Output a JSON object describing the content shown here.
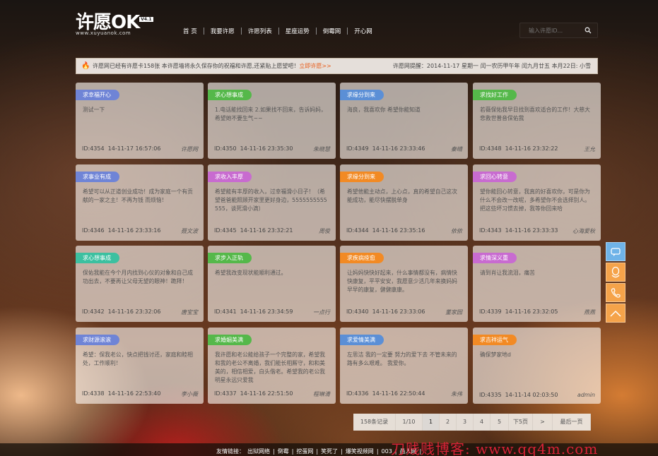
{
  "logo": {
    "main": "许愿OK",
    "badge": "V4.1",
    "sub": "www.xuyuanok.com"
  },
  "nav": [
    "首 页",
    "我要许愿",
    "许愿列表",
    "星座运势",
    "倒霉网",
    "开心网"
  ],
  "search": {
    "placeholder": "输入许愿ID..."
  },
  "notice": {
    "text": "许愿网已经有许愿卡158张   本许愿墙将永久保存你的祝福和许愿,还紧贴上愿望吧！",
    "link": "立即许愿>>",
    "date": "许愿网提醒：2014-11-17 星期一  闰一农历甲午年 闰九月廿五 本月22日: 小雪"
  },
  "cards": [
    {
      "tag": "求幸福开心",
      "color": "#6f84d6",
      "content": "测试一下",
      "id": "ID:4354",
      "time": "14-11-17 16:57:06",
      "author": "许愿网"
    },
    {
      "tag": "求心想事成",
      "color": "#55b84a",
      "content": "1.电话能找回来  2.如果找不回来，告诉妈妈，希望她不要生气~~",
      "id": "ID:4350",
      "time": "14-11-16 23:35:30",
      "author": "朱晓慧"
    },
    {
      "tag": "求缘分到来",
      "color": "#5b8fd6",
      "content": "海良，我喜欢你    希望你能知道",
      "id": "ID:4349",
      "time": "14-11-16 23:33:46",
      "author": "秦晴"
    },
    {
      "tag": "求找好工作",
      "color": "#55b84a",
      "content": "若薇保佑我早日找到喜欢适合的工作！大慈大悲救世普音保佑我",
      "id": "ID:4348",
      "time": "14-11-16 23:32:22",
      "author": "王允"
    },
    {
      "tag": "求事业有成",
      "color": "#6f84d6",
      "content": "希望可以从正道创业成功！成为家庭一个有贡献的一家之主！不再为钱    而烦恼！",
      "id": "ID:4346",
      "time": "14-11-16 23:33:16",
      "author": "聂文波"
    },
    {
      "tag": "求收入丰厚",
      "color": "#c86bd0",
      "content": "希望能有丰厚的收入，过幸福滑小日子！（希望爸爸能照顾开家里更好身边，5555555555555，谈死滑小滴）",
      "id": "ID:4345",
      "time": "14-11-16 23:32:21",
      "author": "周俊"
    },
    {
      "tag": "求缘分到来",
      "color": "#f28a24",
      "content": "希望他能主动点，上心点，真的希望自己这次能成功，能尽快摆脱单身",
      "id": "ID:4344",
      "time": "14-11-16 23:35:16",
      "author": "依依"
    },
    {
      "tag": "求回心转意",
      "color": "#c86bd0",
      "content": "望你能回心转意，我真的好喜欢你，可是你为什么不会改一改呢，多希望你不会选择别人。把这些坏习惯去掉，我等你回来哈",
      "id": "ID:4343",
      "time": "14-11-16 23:33:33",
      "author": "心海爱秋"
    },
    {
      "tag": "求心想事成",
      "color": "#3cc0a0",
      "content": "保佑我能在今个月内找到心仪的对象和自己成功出去，不要再让父母无望的眼神！跪拜！",
      "id": "ID:4342",
      "time": "14-11-16 23:32:06",
      "author": "唐宝宝"
    },
    {
      "tag": "求步入正轨",
      "color": "#55b84a",
      "content": "希望我改变现状能顺利通过。",
      "id": "ID:4341",
      "time": "14-11-16 23:34:59",
      "author": "一点行"
    },
    {
      "tag": "求疾病痊愈",
      "color": "#f28a24",
      "content": "让妈妈快快好起来，什么事情都没有，病情快快康复，平平安安，我愿意少活几年来换妈妈早早的康复，健健康康。",
      "id": "ID:4340",
      "time": "14-11-16 23:33:06",
      "author": "董家园"
    },
    {
      "tag": "求情深义重",
      "color": "#c86bd0",
      "content": "请到肖让我流泪，痛苦",
      "id": "ID:4339",
      "time": "14-11-16 23:32:05",
      "author": "燕燕"
    },
    {
      "tag": "求财源滚滚",
      "color": "#6f84d6",
      "content": "希望：保我老公，快点把钱讨还，家庭和睦相处，工作顺利！",
      "id": "ID:4338",
      "time": "14-11-16 22:53:40",
      "author": "李小薇"
    },
    {
      "tag": "求婚姻美满",
      "color": "#55b84a",
      "content": "我许愿和老公能给孩子一个完整的家，希望我和我的老公不离婚，我们能长相厮守，和和美美的，相信相爱，白头偕老。希望我的老公我明星永远只爱我",
      "id": "ID:4337",
      "time": "14-11-16 22:51:50",
      "author": "程琳清"
    },
    {
      "tag": "求爱情美满",
      "color": "#5b8fd6",
      "content": "左思洁 我的一定要 努力的爱下去 不管未来的路有多么艰难。    我爱你。",
      "id": "ID:4336",
      "time": "14-11-16 22:50:44",
      "author": "朱伟"
    },
    {
      "tag": "求吉祥运气",
      "color": "#f28a24",
      "content": "确保梦家地d",
      "id": "ID:4335",
      "time": "14-11-14 02:03:50",
      "author": "admin"
    }
  ],
  "pager": [
    "158条记录",
    "1/10",
    "1",
    "2",
    "3",
    "4",
    "5",
    "下5页",
    ">",
    "最后一页"
  ],
  "footer": {
    "links": [
      "友情链接：",
      "出狱网络",
      "|",
      "倒霉",
      "|",
      "挖蛋网",
      "|",
      "笑死了",
      "|",
      "爆笑视频网",
      "|",
      "003",
      "|",
      "愚人网",
      "|"
    ]
  },
  "watermark": "刀贱贱博客: www.qq4m.com"
}
